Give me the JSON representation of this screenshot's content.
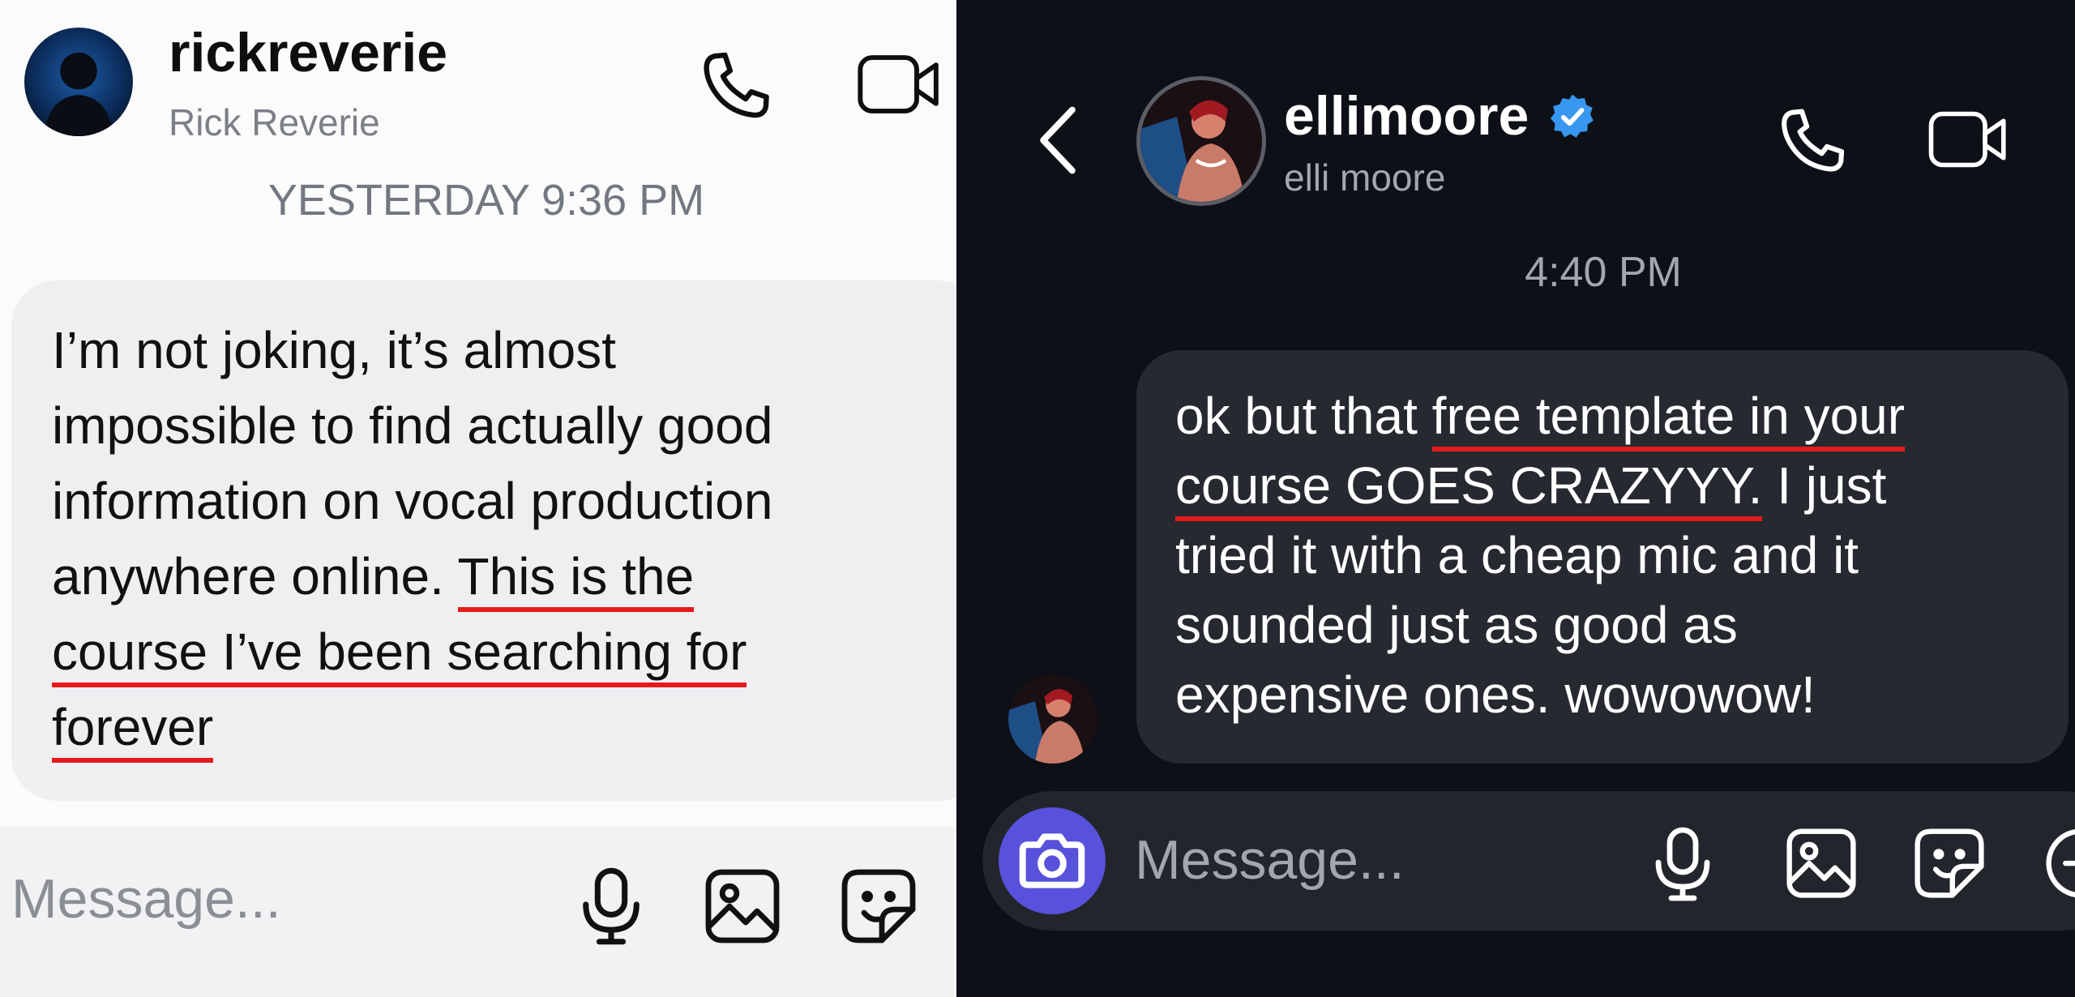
{
  "left_chat": {
    "header": {
      "username": "rickreverie",
      "display_name": "Rick Reverie",
      "avatar_icon": "profile-photo-icon"
    },
    "timestamp": "YESTERDAY 9:36 PM",
    "message": {
      "lines": [
        "I’m not joking, it’s almost",
        "impossible to find actually good",
        "information on vocal production",
        "anywhere online.",
        "This is the",
        "course I’ve been searching for",
        "forever"
      ]
    },
    "composer": {
      "placeholder": "Message..."
    },
    "colors": {
      "background": "#fbfbfc",
      "bubble": "#efeff1",
      "text": "#111111",
      "underline": "#e41b1b"
    }
  },
  "right_chat": {
    "header": {
      "username": "ellimoore",
      "display_name": "elli moore",
      "verified": true
    },
    "timestamp": "4:40 PM",
    "message": {
      "line1_plain": "ok but that ",
      "line1_underlined": "free template in your",
      "line2_underlined": "course GOES CRAZYYY.",
      "line2_plain": " I just",
      "line3": "tried it with a cheap mic and it",
      "line4": "sounded just as good as",
      "line5": "expensive ones. wowowow!"
    },
    "composer": {
      "placeholder": "Message..."
    },
    "colors": {
      "background": "#0d1016",
      "bubble": "#262a30",
      "text": "#ffffff",
      "verified": "#3897f0",
      "camera": "#5851db",
      "underline": "#e41b1b"
    }
  }
}
